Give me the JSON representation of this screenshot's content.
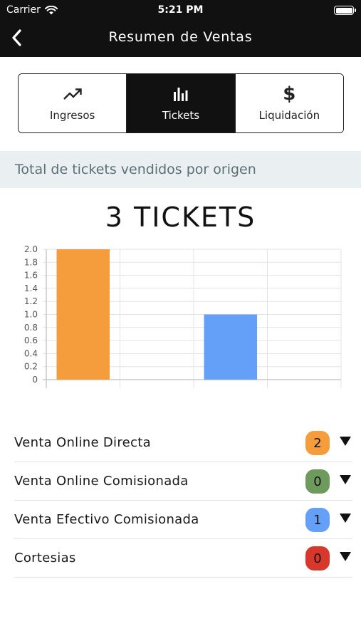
{
  "status": {
    "carrier": "Carrier",
    "time": "5:21 PM"
  },
  "nav": {
    "title": "Resumen de Ventas",
    "back_icon": "chevron-left-icon"
  },
  "tabs": [
    {
      "label": "Ingresos",
      "icon": "trending-up-icon",
      "active": false
    },
    {
      "label": "Tickets",
      "icon": "bar-chart-icon",
      "active": true
    },
    {
      "label": "Liquidación",
      "icon": "dollar-icon",
      "glyph": "$",
      "active": false
    }
  ],
  "section": {
    "title": "Total de tickets vendidos por origen"
  },
  "summary": {
    "total_label": "3 TICKETS"
  },
  "chart_data": {
    "type": "bar",
    "categories": [
      "Venta Online Directa",
      "Venta Online Comisionada",
      "Venta Efectivo Comisionada",
      "Cortesias"
    ],
    "values": [
      2,
      0,
      1,
      0
    ],
    "colors": [
      "#f59d3c",
      "#6e9a5e",
      "#64a0f7",
      "#d8382c"
    ],
    "ylim": [
      0,
      2
    ],
    "yticks": [
      "2.0",
      "1.8",
      "1.6",
      "1.4",
      "1.2",
      "1.0",
      "0.8",
      "0.6",
      "0.4",
      "0.2",
      "0"
    ],
    "grid": true,
    "legend": "none"
  },
  "origins": [
    {
      "label": "Venta Online Directa",
      "count": "2",
      "color": "#f59d3c"
    },
    {
      "label": "Venta Online Comisionada",
      "count": "0",
      "color": "#6e9a5e"
    },
    {
      "label": "Venta Efectivo Comisionada",
      "count": "1",
      "color": "#64a0f7"
    },
    {
      "label": "Cortesias",
      "count": "0",
      "color": "#d8382c"
    }
  ],
  "row_caret_icon": "triangle-down-icon"
}
